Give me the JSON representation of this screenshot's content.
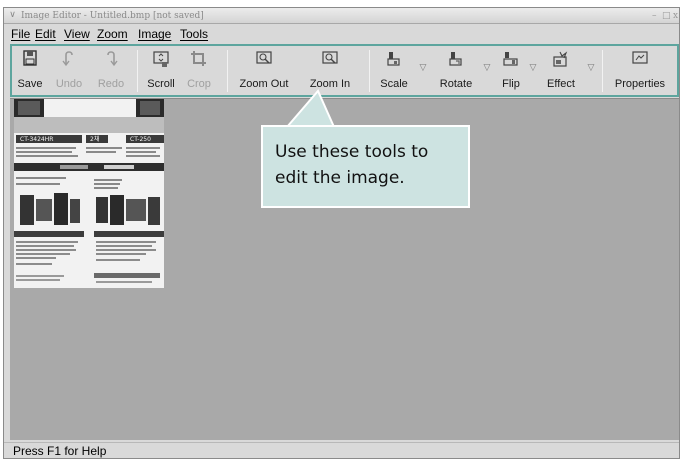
{
  "window": {
    "title": "Image Editor - Untitled.bmp [not saved]",
    "menu_glyph": "∨",
    "controls": [
      "–",
      "□",
      "x"
    ]
  },
  "menu": [
    "File",
    "Edit",
    "View",
    "Zoom",
    "Image",
    "Tools"
  ],
  "toolbar": {
    "buttons": [
      {
        "label": "Save",
        "enabled": true
      },
      {
        "label": "Undo",
        "enabled": false
      },
      {
        "label": "Redo",
        "enabled": false
      },
      {
        "label": "Scroll",
        "enabled": true
      },
      {
        "label": "Crop",
        "enabled": false
      },
      {
        "label": "Zoom Out",
        "enabled": true
      },
      {
        "label": "Zoom In",
        "enabled": true
      },
      {
        "label": "Scale",
        "enabled": true
      },
      {
        "label": "Rotate",
        "enabled": true
      },
      {
        "label": "Flip",
        "enabled": true
      },
      {
        "label": "Effect",
        "enabled": true
      },
      {
        "label": "Properties",
        "enabled": true
      }
    ],
    "dropdown_glyph": "▽"
  },
  "thumbnail": {
    "labels": [
      "CT-3424HR",
      "2채",
      "CT-250"
    ]
  },
  "status": {
    "text": "Press F1 for Help"
  },
  "callout": {
    "text": "Use these tools to edit the image."
  },
  "colors": {
    "toolbar_highlight": "#5da59e",
    "callout_bg": "#cde3e1",
    "canvas_bg": "#a9a9a9",
    "window_bg": "#d9d9d9"
  }
}
